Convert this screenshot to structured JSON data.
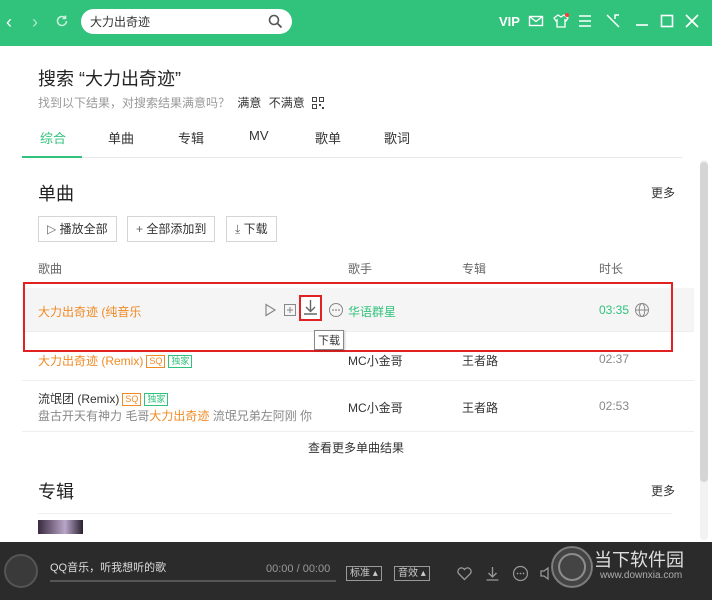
{
  "search": {
    "value": "大力出奇迹",
    "placeholder": ""
  },
  "topbar": {
    "vip": "VIP"
  },
  "header": {
    "title": "搜索 “大力出奇迹”",
    "feedback_prompt": "找到以下结果，对搜索结果满意吗？",
    "satisfied": "满意",
    "unsatisfied": "不满意"
  },
  "tabs": [
    "综合",
    "单曲",
    "专辑",
    "MV",
    "歌单",
    "歌词"
  ],
  "songs_section": {
    "title": "单曲",
    "more": "更多",
    "buttons": {
      "play_all": "播放全部",
      "add_all": "全部添加到",
      "download": "下载"
    },
    "columns": {
      "song": "歌曲",
      "singer": "歌手",
      "album": "专辑",
      "duration": "时长"
    },
    "rows": [
      {
        "title": "大力出奇迹 (纯音乐",
        "singer": "华语群星",
        "album": "",
        "duration": "03:35"
      },
      {
        "title": "大力出奇迹 (Remix)",
        "tag1": "SQ",
        "tag2": "独家",
        "singer": "MC小金哥",
        "album": "王者路",
        "duration": "02:37"
      },
      {
        "title": "流氓团 (Remix)",
        "tag1": "SQ",
        "tag2": "独家",
        "lyric_before": "盘古开天有神力 毛哥",
        "lyric_hl": "大力出奇迹",
        "lyric_after": " 流氓兄弟左阿刚 你",
        "singer": "MC小金哥",
        "album": "王者路",
        "duration": "02:53"
      }
    ],
    "tooltip": "下载",
    "see_more": "查看更多单曲结果"
  },
  "albums_section": {
    "title": "专辑",
    "more": "更多"
  },
  "player": {
    "title": "QQ音乐，听我想听的歌",
    "time": "00:00 / 00:00",
    "quality": "标准",
    "effect": "音效"
  },
  "watermark": {
    "name": "当下软件园",
    "url": "www.downxia.com"
  },
  "colors": {
    "brand": "#31c27c",
    "highlight": "#f08a24",
    "annotation": "#e02222"
  }
}
